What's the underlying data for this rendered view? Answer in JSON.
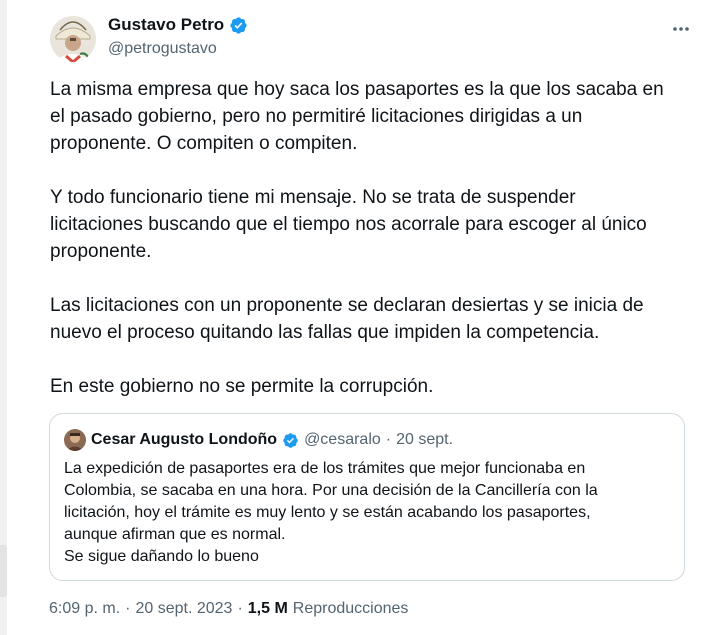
{
  "author": {
    "display_name": "Gustavo Petro",
    "handle": "@petrogustavo",
    "verified_icon": "verified-badge-icon"
  },
  "tweet": {
    "paragraphs": [
      [
        "La misma empresa que hoy saca los pasaportes es la que los sacaba en",
        "el pasado gobierno, pero no permitiré licitaciones dirigidas a un",
        "proponente. O compiten o compiten."
      ],
      [
        "Y todo funcionario tiene mi mensaje. No se trata de suspender",
        "licitaciones buscando que el tiempo nos acorrale para escoger al único",
        "proponente."
      ],
      [
        "Las licitaciones con un proponente se declaran desiertas y se inicia de",
        "nuevo el proceso quitando las fallas que impiden la competencia."
      ],
      [
        "En este gobierno no se permite la corrupción."
      ]
    ]
  },
  "quoted_tweet": {
    "display_name": "Cesar Augusto Londoño",
    "handle": "@cesaralo",
    "separator": "·",
    "date": "20 sept.",
    "lines": [
      "La expedición de pasaportes era de los trámites que mejor funcionaba en",
      "Colombia, se sacaba en una hora. Por una decisión de la Cancillería con la",
      "licitación, hoy el trámite es muy lento y se están acabando los pasaportes,",
      "aunque afirman que es normal.",
      "Se sigue dañando lo bueno"
    ]
  },
  "meta": {
    "time": "6:09 p. m.",
    "separator": "·",
    "date": "20 sept. 2023",
    "views_count": "1,5 M",
    "views_label": "Reproducciones"
  },
  "colors": {
    "text": "#0f1419",
    "secondary": "#536471",
    "verified": "#1d9bf0",
    "border": "#cfd9de"
  }
}
